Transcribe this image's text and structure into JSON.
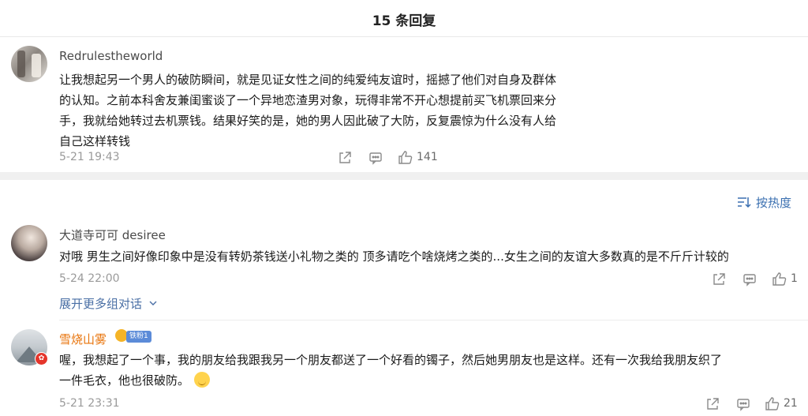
{
  "header": {
    "title": "15 条回复"
  },
  "sort_label": "按热度",
  "comments": [
    {
      "user": "Redrulestheworld",
      "lines": [
        "让我想起另一个男人的破防瞬间，就是见证女性之间的纯爱纯友谊时，摇撼了他们对自身及群体",
        "的认知。之前本科舍友兼闺蜜谈了一个异地恋渣男对象，玩得非常不开心想提前买飞机票回来分",
        "手，我就给她转过去机票钱。结果好笑的是，她的男人因此破了大防，反复震惊为什么没有人给",
        "自己这样转钱"
      ],
      "time": "5-21 19:43",
      "likes": "141"
    },
    {
      "user": "大道寺可可 desiree",
      "lines": [
        "对哦 男生之间好像印象中是没有转奶茶钱送小礼物之类的 顶多请吃个啥烧烤之类的...女生之间的友谊大多数真的是不斤斤计较的"
      ],
      "time": "5-24 22:00",
      "likes": "1",
      "more_replies": "展开更多组对话"
    },
    {
      "user": "雪烧山雾",
      "member_tag": "铁粉1",
      "lines": [
        "喔，我想起了一个事，我的朋友给我跟我另一个朋友都送了一个好看的镯子，然后她男朋友也是这样。还有一次我给我朋友织了",
        "一件毛衣，他也很破防。"
      ],
      "time": "5-21 23:31",
      "likes": "21",
      "badge_glyph": "✿"
    }
  ],
  "colors": {
    "link": "#3a6fb0",
    "vip_name": "#e8730a",
    "muted": "#9a9a9a"
  }
}
